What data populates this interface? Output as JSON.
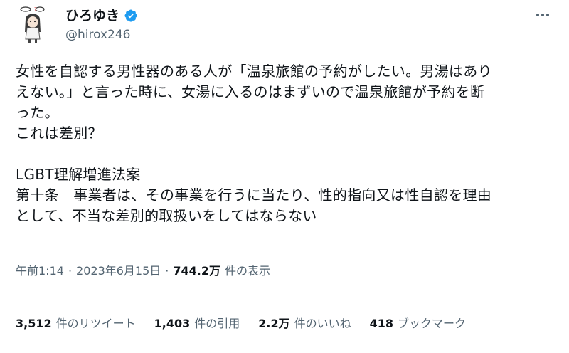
{
  "user": {
    "display_name": "ひろゆき",
    "handle": "@hirox246",
    "verified_icon": "verified-badge-icon",
    "avatar_icon": "avatar-illustration"
  },
  "tweet": {
    "text": "女性を自認する男性器のある人が「温泉旅館の予約がしたい。男湯はあり\nえない。」と言った時に、女湯に入るのはまずいので温泉旅館が予約を断\nった。\nこれは差別？\n\nLGBT理解増進法案\n第十条　事業者は、その事業を行うに当たり、性的指向又は性自認を理由\nとして、不当な差別的取扱いをしてはならない"
  },
  "meta": {
    "time": "午前1:14",
    "date": "2023年6月15日",
    "separator": "·",
    "views_count": "744.2万",
    "views_label": "件の表示"
  },
  "stats": {
    "retweets_count": "3,512",
    "retweets_label": "件のリツイート",
    "quotes_count": "1,403",
    "quotes_label": "件の引用",
    "likes_count": "2.2万",
    "likes_label": "件のいいね",
    "bookmarks_count": "418",
    "bookmarks_label": "ブックマーク"
  },
  "colors": {
    "text": "#0f1419",
    "secondary": "#536471",
    "verified": "#1d9bf0",
    "divider": "#eff3f4"
  }
}
